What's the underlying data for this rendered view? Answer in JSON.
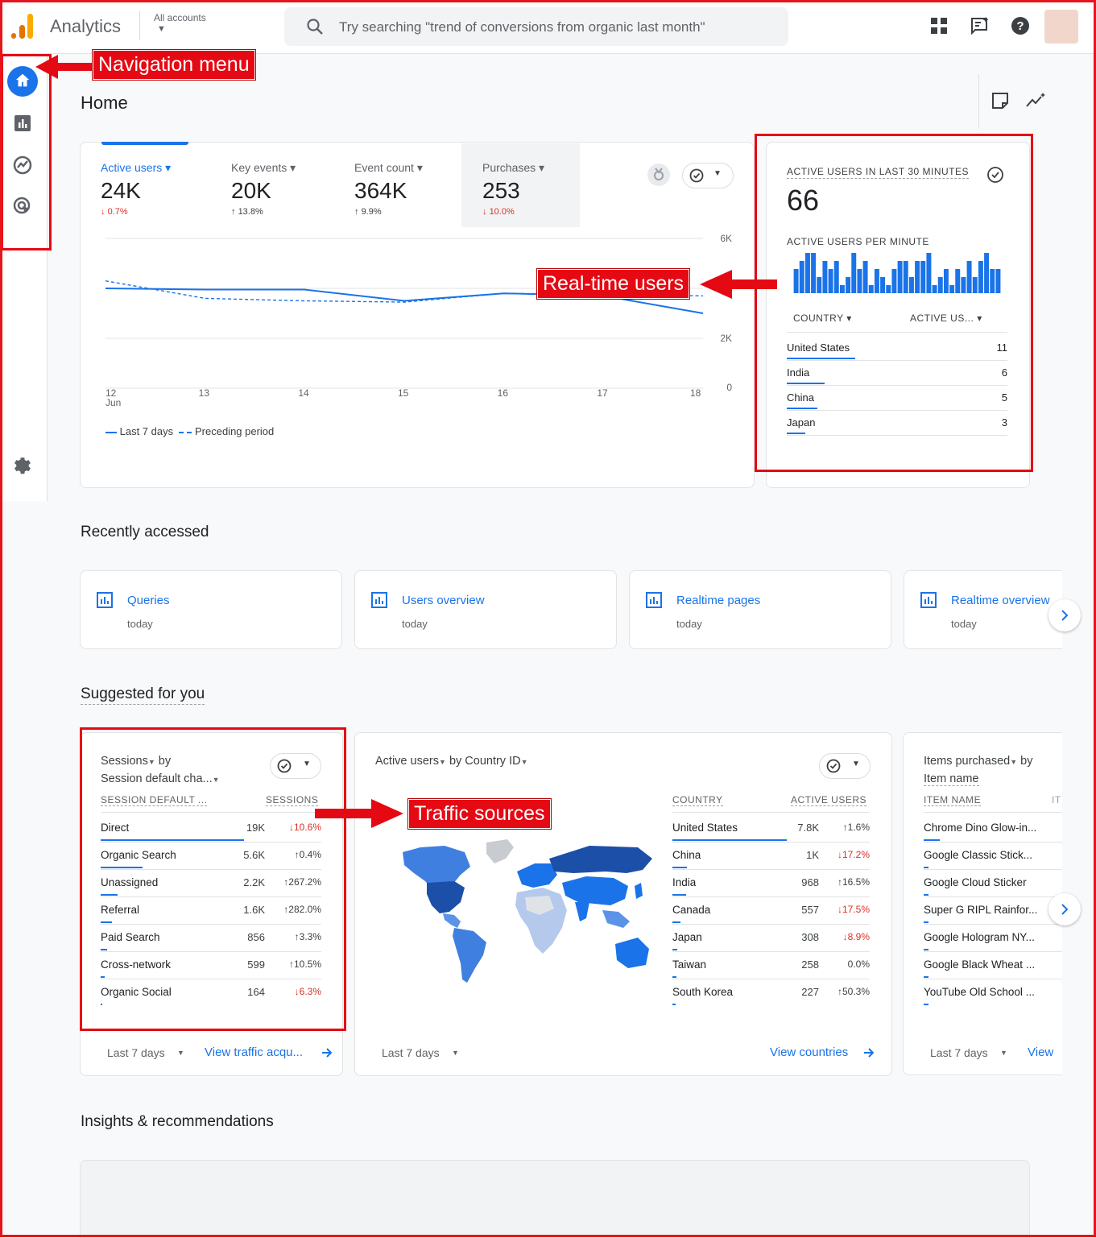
{
  "app": {
    "title": "Analytics",
    "accounts_label": "All accounts"
  },
  "search": {
    "placeholder": "Try searching \"trend of conversions from organic last month\""
  },
  "annotations": {
    "nav_menu": "Navigation menu",
    "realtime": "Real-time users",
    "traffic": "Traffic sources"
  },
  "page": {
    "title": "Home"
  },
  "overview": {
    "metrics": [
      {
        "label": "Active users",
        "value": "24K",
        "change": "0.7%",
        "dir": "down"
      },
      {
        "label": "Key events",
        "value": "20K",
        "change": "13.8%",
        "dir": "up"
      },
      {
        "label": "Event count",
        "value": "364K",
        "change": "9.9%",
        "dir": "up"
      },
      {
        "label": "Purchases",
        "value": "253",
        "change": "10.0%",
        "dir": "down"
      }
    ],
    "y_ticks": [
      "6K",
      "2K",
      "0"
    ],
    "x_ticks": [
      "12",
      "13",
      "14",
      "15",
      "16",
      "17",
      "18"
    ],
    "x_month": "Jun",
    "legend": {
      "current": "Last 7 days",
      "previous": "Preceding period"
    }
  },
  "chart_data": {
    "type": "line",
    "x": [
      "12 Jun",
      "13",
      "14",
      "15",
      "16",
      "17",
      "18"
    ],
    "yticks": [
      "6K",
      "2K",
      "0"
    ],
    "series": [
      {
        "name": "Last 7 days",
        "values": [
          4000,
          3950,
          3950,
          3500,
          3800,
          3700,
          3000
        ]
      },
      {
        "name": "Preceding period",
        "values": [
          4300,
          3600,
          3500,
          3450,
          3800,
          3750,
          3700
        ]
      }
    ],
    "ylim": [
      0,
      6000
    ]
  },
  "realtime": {
    "title": "ACTIVE USERS IN LAST 30 MINUTES",
    "value": "66",
    "per_minute_label": "ACTIVE USERS PER MINUTE",
    "per_minute": [
      3,
      4,
      5,
      5,
      2,
      4,
      3,
      4,
      1,
      2,
      5,
      3,
      4,
      1,
      3,
      2,
      1,
      3,
      4,
      4,
      2,
      4,
      4,
      5,
      1,
      2,
      3,
      1,
      3,
      2,
      4,
      2,
      4,
      5,
      3,
      3
    ],
    "col_country": "COUNTRY",
    "col_users": "ACTIVE US...",
    "rows": [
      {
        "country": "United States",
        "users": "11",
        "share": 1.0
      },
      {
        "country": "India",
        "users": "6",
        "share": 0.55
      },
      {
        "country": "China",
        "users": "5",
        "share": 0.45
      },
      {
        "country": "Japan",
        "users": "3",
        "share": 0.27
      }
    ]
  },
  "recent": {
    "title": "Recently accessed",
    "items": [
      {
        "title": "Queries",
        "sub": "today"
      },
      {
        "title": "Users overview",
        "sub": "today"
      },
      {
        "title": "Realtime pages",
        "sub": "today"
      },
      {
        "title": "Realtime overview",
        "sub": "today"
      }
    ]
  },
  "suggested": {
    "title": "Suggested for you",
    "sessions": {
      "title_metric": "Sessions",
      "title_by": "by",
      "title_dim": "Session default cha...",
      "col1": "SESSION DEFAULT ...",
      "col2": "SESSIONS",
      "rows": [
        {
          "name": "Direct",
          "value": "19K",
          "change": "10.6%",
          "dir": "down",
          "share": 1.0
        },
        {
          "name": "Organic Search",
          "value": "5.6K",
          "change": "0.4%",
          "dir": "up",
          "share": 0.29
        },
        {
          "name": "Unassigned",
          "value": "2.2K",
          "change": "267.2%",
          "dir": "up",
          "share": 0.12
        },
        {
          "name": "Referral",
          "value": "1.6K",
          "change": "282.0%",
          "dir": "up",
          "share": 0.08
        },
        {
          "name": "Paid Search",
          "value": "856",
          "change": "3.3%",
          "dir": "up",
          "share": 0.045
        },
        {
          "name": "Cross-network",
          "value": "599",
          "change": "10.5%",
          "dir": "up",
          "share": 0.03
        },
        {
          "name": "Organic Social",
          "value": "164",
          "change": "6.3%",
          "dir": "down",
          "share": 0.01
        }
      ],
      "footer_range": "Last 7 days",
      "footer_link": "View traffic acqu..."
    },
    "country": {
      "title_metric": "Active users",
      "title_dim": "by Country ID",
      "col1": "COUNTRY",
      "col2": "ACTIVE USERS",
      "rows": [
        {
          "name": "United States",
          "value": "7.8K",
          "change": "1.6%",
          "dir": "up",
          "share": 1.0
        },
        {
          "name": "China",
          "value": "1K",
          "change": "17.2%",
          "dir": "down",
          "share": 0.13
        },
        {
          "name": "India",
          "value": "968",
          "change": "16.5%",
          "dir": "up",
          "share": 0.12
        },
        {
          "name": "Canada",
          "value": "557",
          "change": "17.5%",
          "dir": "down",
          "share": 0.07
        },
        {
          "name": "Japan",
          "value": "308",
          "change": "8.9%",
          "dir": "down",
          "share": 0.04
        },
        {
          "name": "Taiwan",
          "value": "258",
          "change": "0.0%",
          "dir": "none",
          "share": 0.033
        },
        {
          "name": "South Korea",
          "value": "227",
          "change": "50.3%",
          "dir": "up",
          "share": 0.03
        }
      ],
      "footer_range": "Last 7 days",
      "footer_link": "View countries"
    },
    "items": {
      "title_metric": "Items purchased",
      "title_by": "by",
      "title_dim": "Item name",
      "col1": "ITEM NAME",
      "col2": "IT",
      "rows": [
        "Chrome Dino Glow-in...",
        "Google Classic Stick...",
        "Google Cloud Sticker",
        "Super G RIPL Rainfor...",
        "Google Hologram NY...",
        "Google Black Wheat ...",
        "YouTube Old School ..."
      ],
      "footer_range": "Last 7 days",
      "footer_link": "View"
    }
  },
  "insights": {
    "title": "Insights & recommendations"
  },
  "colors": {
    "accent": "#1a73e8",
    "annotation": "#e50914",
    "down": "#d93025"
  }
}
